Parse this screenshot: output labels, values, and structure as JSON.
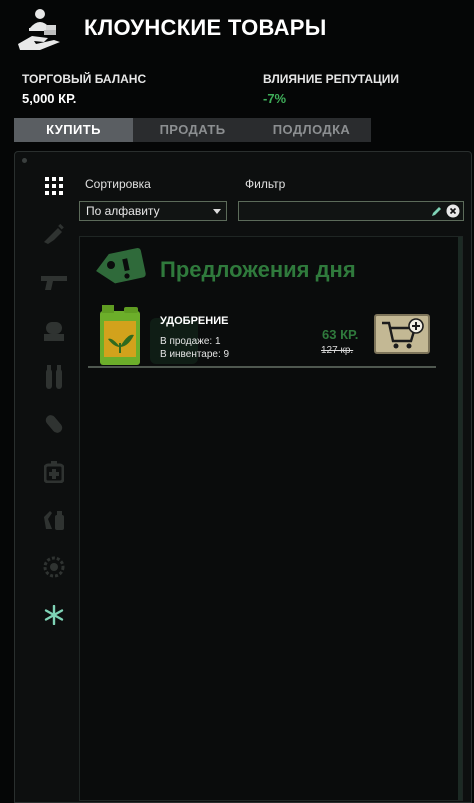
{
  "header": {
    "title": "КЛОУНСКИЕ ТОВАРЫ",
    "balance_label": "ТОРГОВЫЙ БАЛАНС",
    "balance_value": "5,000 КР.",
    "reputation_label": "ВЛИЯНИЕ РЕПУТАЦИИ",
    "reputation_value": "-7%"
  },
  "tabs": [
    "КУПИТЬ",
    "ПРОДАТЬ",
    "ПОДЛОДКА"
  ],
  "active_tab": "КУПИТЬ",
  "sidebar": {
    "icons": [
      "grid-icon",
      "syringe-icon",
      "gun-icon",
      "diving-helmet-icon",
      "ammo-icon",
      "pill-icon",
      "medkit-icon",
      "chemicals-icon",
      "gear-icon",
      "snowflake-icon"
    ]
  },
  "controls": {
    "sort_label": "Сортировка",
    "sort_value": "По алфавиту",
    "filter_label": "Фильтр",
    "filter_value": ""
  },
  "deals": {
    "title": "Предложения дня",
    "items": [
      {
        "name": "УДОБРЕНИЕ",
        "for_sale": "В продаже: 1",
        "in_inventory": "В инвентаре: 9",
        "price": "63 КР.",
        "old_price": "127 кр."
      }
    ]
  },
  "colors": {
    "accent_green": "#2f7a3c",
    "reputation_green": "#3fae59",
    "buy_button": "#c3b894"
  }
}
